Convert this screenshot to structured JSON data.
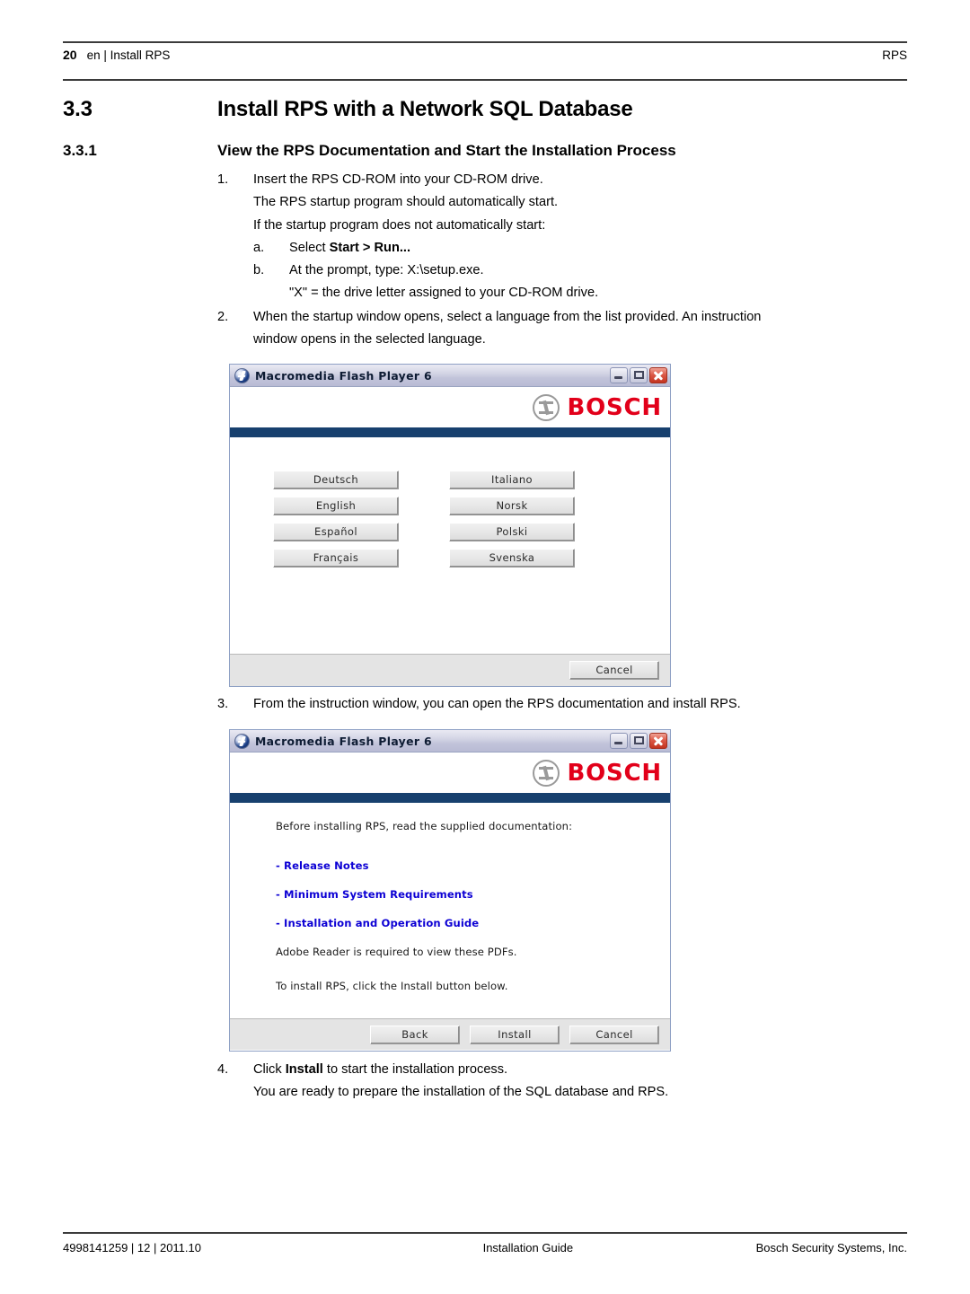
{
  "header": {
    "page_number": "20",
    "breadcrumb": "en | Install RPS",
    "right_label": "RPS"
  },
  "sections": {
    "h2_number": "3.3",
    "h2_title": "Install RPS with a Network SQL Database",
    "h3_number": "3.3.1",
    "h3_title": "View the RPS Documentation and Start the Installation Process"
  },
  "steps": {
    "step1": {
      "marker": "1.",
      "text": "Insert the RPS CD-ROM into your CD-ROM drive.",
      "line2": "The RPS startup program should automatically start.",
      "line3": "If the startup program does not automatically start:",
      "sub_a_marker": "a.",
      "sub_a_prefix": "Select ",
      "sub_a_bold": "Start > Run...",
      "sub_b_marker": "b.",
      "sub_b_text": "At the prompt, type: X:\\setup.exe.",
      "sub_b_note": "\"X\" = the drive letter assigned to your CD-ROM drive."
    },
    "step2": {
      "marker": "2.",
      "line1": "When the startup window opens, select a language from the list provided. An instruction",
      "line2": "window opens in the selected language."
    },
    "step3": {
      "marker": "3.",
      "text": "From the instruction window, you can open the RPS documentation and install RPS."
    },
    "step4": {
      "marker": "4.",
      "prefix": "Click ",
      "bold": "Install",
      "suffix": " to start the installation process.",
      "line2": "You are ready to prepare the installation of the SQL database and RPS."
    }
  },
  "dialog_language": {
    "title": "Macromedia Flash Player 6",
    "brand": "BOSCH",
    "icons": {
      "app": "flash-player-icon",
      "minimize": "minimize-icon",
      "maximize": "maximize-icon",
      "close": "close-icon",
      "brand_mark": "bosch-emblem-icon"
    },
    "languages": [
      "Deutsch",
      "Italiano",
      "English",
      "Norsk",
      "Español",
      "Polski",
      "Français",
      "Svenska"
    ],
    "cancel_label": "Cancel"
  },
  "dialog_documentation": {
    "title": "Macromedia Flash Player 6",
    "brand": "BOSCH",
    "intro": "Before installing RPS, read the supplied documentation:",
    "links": [
      "- Release Notes",
      "- Minimum System Requirements",
      "- Installation and Operation Guide"
    ],
    "note_reader": "Adobe Reader is required to view these PDFs.",
    "note_install": "To install RPS, click the Install button below.",
    "buttons": {
      "back": "Back",
      "install": "Install",
      "cancel": "Cancel"
    }
  },
  "footer": {
    "left": "4998141259 | 12 | 2011.10",
    "center": "Installation Guide",
    "right": "Bosch Security Systems, Inc."
  },
  "colors": {
    "brand_red": "#e2001a",
    "navy_bar": "#17406e",
    "link_blue": "#0c00d4",
    "rule": "#3b3b3b"
  }
}
